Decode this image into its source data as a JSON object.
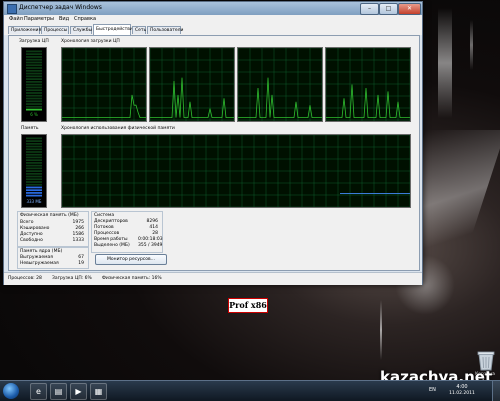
{
  "window": {
    "title": "Диспетчер задач Windows",
    "menu": [
      "Файл",
      "Параметры",
      "Вид",
      "Справка"
    ],
    "tabs": [
      "Приложения",
      "Процессы",
      "Службы",
      "Быстродействие",
      "Сеть",
      "Пользователи"
    ],
    "active_tab_index": 3,
    "controls": {
      "minimize": "–",
      "maximize": "□",
      "close": "✕"
    }
  },
  "performance": {
    "cpu_usage": {
      "label": "Загрузка ЦП",
      "value": "6 %",
      "percent": 6
    },
    "cpu_history_label": "Хронология загрузки ЦП",
    "cpu_cores": 4,
    "memory": {
      "label": "Память",
      "value": "333 МБ",
      "fill_percent": 17
    },
    "memory_history_label": "Хронология использования физической памяти",
    "memory_history_level_percent": 17,
    "physical_memory": {
      "heading": "Физическая память (МБ)",
      "rows": [
        {
          "label": "Всего",
          "value": "1975"
        },
        {
          "label": "Кэшировано",
          "value": "266"
        },
        {
          "label": "Доступно",
          "value": "1586"
        },
        {
          "label": "Свободно",
          "value": "1333"
        }
      ]
    },
    "kernel_memory": {
      "heading": "Память ядра (МБ)",
      "rows": [
        {
          "label": "Выгружаемая",
          "value": "67"
        },
        {
          "label": "Невыгружаемая",
          "value": "19"
        }
      ]
    },
    "system": {
      "heading": "Система",
      "rows": [
        {
          "label": "Дескрипторов",
          "value": "8296"
        },
        {
          "label": "Потоков",
          "value": "414"
        },
        {
          "label": "Процессов",
          "value": "28"
        },
        {
          "label": "Время работы",
          "value": "0:00:18:03"
        },
        {
          "label": "Выделено (МБ)",
          "value": "355 / 3949"
        }
      ]
    },
    "resource_monitor_button": "Монитор ресурсов..."
  },
  "statusbar": {
    "processes": "Процессов: 28",
    "cpu": "Загрузка ЦП: 6%",
    "memory": "Физическая память: 16%"
  },
  "desktop": {
    "badge": "Prof x86",
    "recycle_bin_label": "Корзина",
    "watermark": "kazachya.net"
  },
  "taskbar": {
    "language": "EN",
    "time": "4:00",
    "date": "11.02.2011"
  },
  "colors": {
    "graph_line": "#2fbf2f",
    "graph_grid": "#0d5a28",
    "memory_line": "#3b7bd8",
    "meter_fill": "#2fbf2f",
    "memory_fill": "#2a6be0"
  }
}
